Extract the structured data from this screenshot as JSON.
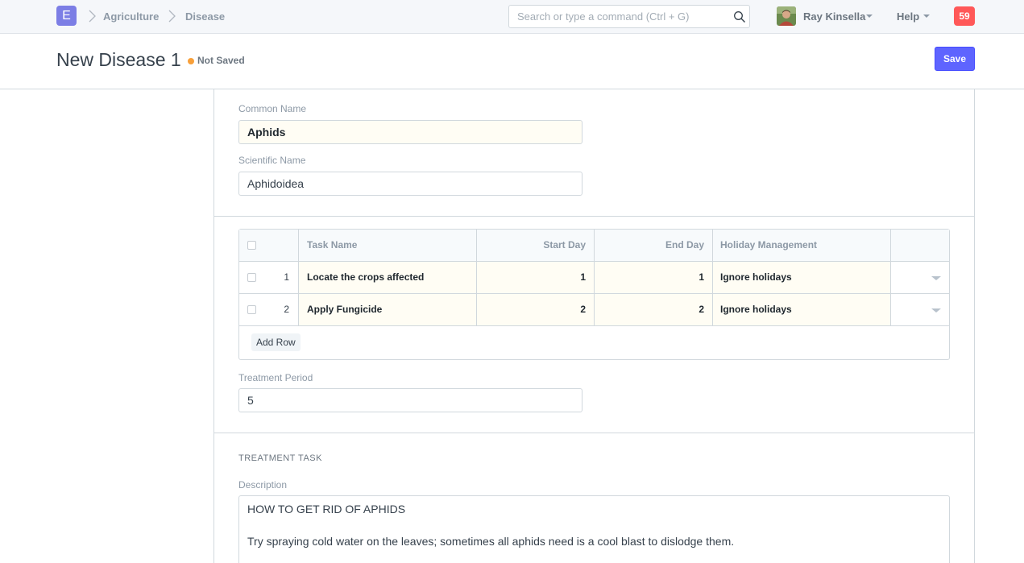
{
  "navbar": {
    "logo_letter": "E",
    "breadcrumbs": [
      "Agriculture",
      "Disease"
    ],
    "search_placeholder": "Search or type a command (Ctrl + G)",
    "user_name": "Ray Kinsella",
    "help_label": "Help",
    "notification_count": "59"
  },
  "page": {
    "title": "New Disease 1",
    "status": "Not Saved",
    "save_label": "Save"
  },
  "form": {
    "common_name_label": "Common Name",
    "common_name_value": "Aphids",
    "scientific_name_label": "Scientific Name",
    "scientific_name_value": "Aphidoidea",
    "treatment_period_label": "Treatment Period",
    "treatment_period_value": "5",
    "section_title": "TREATMENT TASK",
    "description_label": "Description",
    "description_value": "HOW TO GET RID OF APHIDS\n\nTry spraying cold water on the leaves; sometimes all aphids need is a cool blast to dislodge them."
  },
  "grid": {
    "columns": [
      "Task Name",
      "Start Day",
      "End Day",
      "Holiday Management"
    ],
    "rows": [
      {
        "idx": "1",
        "task_name": "Locate the crops affected",
        "start_day": "1",
        "end_day": "1",
        "holiday": "Ignore holidays"
      },
      {
        "idx": "2",
        "task_name": "Apply Fungicide",
        "start_day": "2",
        "end_day": "2",
        "holiday": "Ignore holidays"
      }
    ],
    "add_row_label": "Add Row"
  },
  "colors": {
    "primary": "#5e64ff",
    "logo": "#7c7ee5",
    "notification": "#ff5858",
    "not_saved_indicator": "#f8a03a"
  }
}
